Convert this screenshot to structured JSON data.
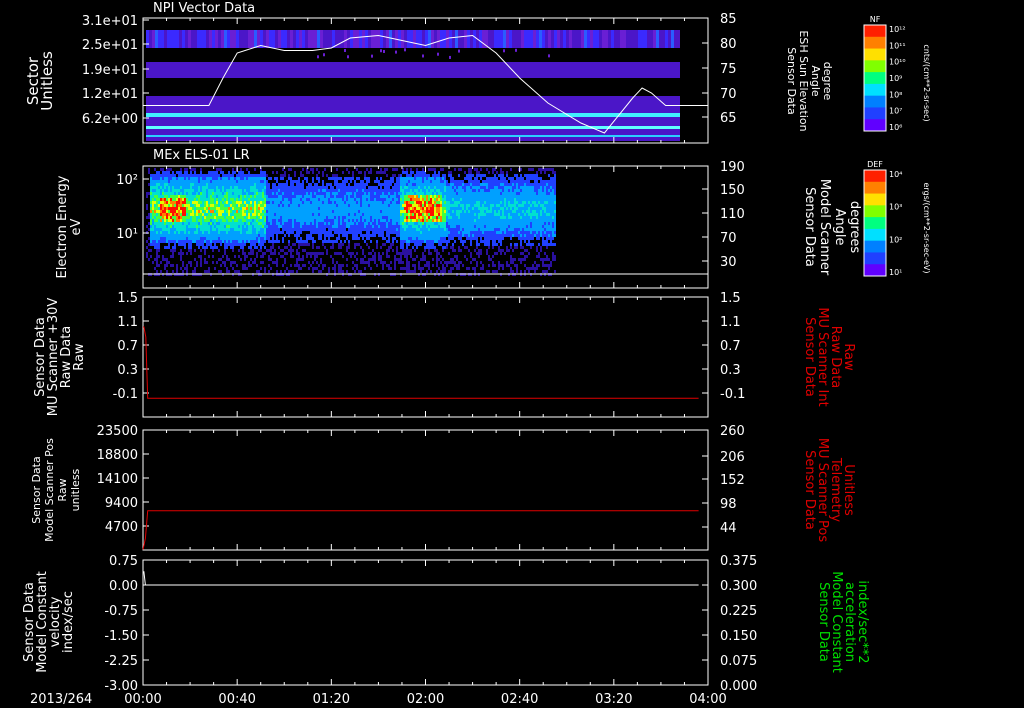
{
  "colors": {
    "background": "#000000",
    "axis": "#ffffff",
    "red_trace": "#e00000",
    "green_label": "#00e000",
    "white_trace": "#ffffff"
  },
  "header_labels": {
    "panel1_title": "NPI Vector Data",
    "panel2_title": "MEx ELS-01 LR",
    "date": "2013/264"
  },
  "colorbars": [
    {
      "title": "NF",
      "unit": "cnts/(cm**2-sr-sec)",
      "ticks": [
        "10¹²",
        "10¹¹",
        "10¹⁰",
        "10⁹",
        "10⁸",
        "10⁷",
        "10⁶"
      ]
    },
    {
      "title": "DEF",
      "unit": "ergs/(cm**2-sr-sec-eV)",
      "ticks": [
        "10⁴",
        "10³",
        "10²",
        "10¹"
      ]
    }
  ],
  "chart_data": [
    {
      "type": "heatmap",
      "title": "NPI Vector Data",
      "ylabel_left": [
        "Sector",
        "Unitless"
      ],
      "ylabel_right": [
        "Sensor Data",
        "ESH Sun Elevation",
        "Angle",
        "degree"
      ],
      "left_ticks": [
        "3.1e+01",
        "2.5e+01",
        "1.9e+01",
        "1.2e+01",
        "6.2e+00"
      ],
      "right_ticks": [
        "85",
        "80",
        "75",
        "70",
        "65"
      ],
      "right_range": [
        60,
        85
      ],
      "overlay_line": {
        "color": "#ffffff",
        "x_minutes": [
          0,
          28,
          34,
          40,
          50,
          60,
          72,
          80,
          88,
          100,
          110,
          120,
          130,
          140,
          150,
          160,
          172,
          186,
          196,
          208,
          212,
          216,
          222,
          236
        ],
        "y_degrees": [
          67.5,
          67.5,
          73,
          78,
          79.5,
          78.5,
          78.5,
          79,
          81,
          81.5,
          80.5,
          79.5,
          81,
          81.5,
          78,
          73,
          68,
          64,
          62,
          69,
          71,
          70,
          67.5,
          67.5
        ]
      }
    },
    {
      "type": "heatmap",
      "title": "MEx ELS-01 LR",
      "ylabel_left": [
        "Electron Energy",
        "eV"
      ],
      "ylabel_right": [
        "Sensor Data",
        "Model Scanner",
        "Angle",
        "degrees"
      ],
      "left_ticks": [
        "10²",
        "10¹"
      ],
      "right_ticks": [
        "190",
        "150",
        "110",
        "70",
        "30"
      ],
      "right_range": [
        0,
        190
      ]
    },
    {
      "type": "line",
      "ylabel_left": [
        "Sensor Data",
        "MU Scanner +30V",
        "Raw Data",
        "Raw"
      ],
      "ylabel_right": [
        "Sensor Data",
        "MU Scanner Int",
        "Raw Data",
        "Raw"
      ],
      "left_ticks": [
        "1.5",
        "1.1",
        "0.7",
        "0.3",
        "-0.1"
      ],
      "right_ticks": [
        "1.5",
        "1.1",
        "0.7",
        "0.3",
        "-0.1"
      ],
      "ylim": [
        -0.3,
        1.5
      ],
      "series": [
        {
          "color": "#e00000",
          "x_minutes": [
            0,
            0.4,
            1.2,
            2,
            236
          ],
          "y": [
            1.05,
            1.05,
            0.9,
            -0.02,
            -0.02
          ]
        }
      ]
    },
    {
      "type": "line",
      "ylabel_left": [
        "Sensor Data",
        "Model Scanner Pos",
        "Raw",
        "unitless"
      ],
      "ylabel_right": [
        "Sensor Data",
        "MU Scanner Pos",
        "Telemetry",
        "Unitless"
      ],
      "left_ticks": [
        "23500",
        "18800",
        "14100",
        "9400",
        "4700"
      ],
      "right_ticks": [
        "260",
        "206",
        "152",
        "98",
        "44"
      ],
      "ylim": [
        0,
        23500
      ],
      "series": [
        {
          "color": "#e00000",
          "x_minutes": [
            0,
            1,
            2,
            236
          ],
          "y": [
            100,
            2300,
            7700,
            7700
          ]
        }
      ]
    },
    {
      "type": "line",
      "ylabel_left": [
        "Sensor Data",
        "Model Constant",
        "velocity",
        "index/sec"
      ],
      "ylabel_right": [
        "Sensor Data",
        "Model Constant",
        "acceleration",
        "index/sec**2"
      ],
      "left_ticks": [
        "0.75",
        "0.00",
        "-0.75",
        "-1.50",
        "-2.25",
        "-3.00"
      ],
      "right_ticks": [
        "0.375",
        "0.300",
        "0.225",
        "0.150",
        "0.075",
        "0.000"
      ],
      "ylim": [
        -3.0,
        0.75
      ],
      "series": [
        {
          "color": "#ffffff",
          "x_minutes": [
            0,
            0.4,
            1,
            236
          ],
          "y": [
            0.4,
            0.4,
            0,
            0
          ]
        }
      ]
    }
  ],
  "x_axis": {
    "tick_labels": [
      "00:00",
      "00:40",
      "01:20",
      "02:00",
      "02:40",
      "03:20",
      "04:00"
    ],
    "range_minutes": [
      0,
      240
    ]
  }
}
